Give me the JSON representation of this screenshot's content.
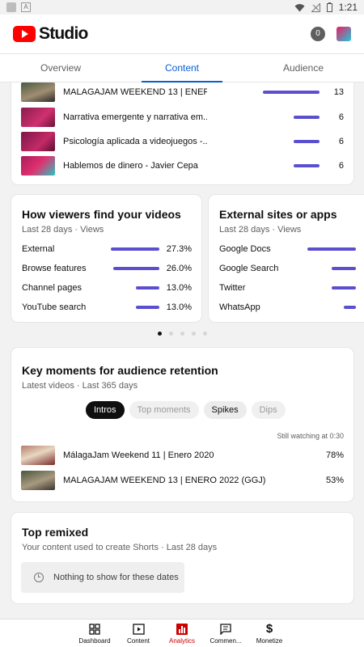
{
  "status_bar": {
    "time": "1:21"
  },
  "header": {
    "logo_text": "Studio",
    "notification_count": "0"
  },
  "tabs": [
    {
      "label": "Overview",
      "active": false
    },
    {
      "label": "Content",
      "active": true
    },
    {
      "label": "Audience",
      "active": false
    }
  ],
  "top_videos": [
    {
      "title": "MALAGAJAM WEEKEND  13 | ENER...",
      "count": "13",
      "bar": 1.0
    },
    {
      "title": "Narrativa emergente y narrativa em...",
      "count": "6",
      "bar": 0.46
    },
    {
      "title": "Psicología aplicada a videojuegos -...",
      "count": "6",
      "bar": 0.46
    },
    {
      "title": "Hablemos de dinero - Javier Cepa",
      "count": "6",
      "bar": 0.46
    }
  ],
  "how_viewers": {
    "title": "How viewers find your videos",
    "subtitle": "Last 28 days · Views",
    "rows": [
      {
        "label": "External",
        "pct": "27.3%",
        "bar": 1.0
      },
      {
        "label": "Browse features",
        "pct": "26.0%",
        "bar": 0.95
      },
      {
        "label": "Channel pages",
        "pct": "13.0%",
        "bar": 0.48
      },
      {
        "label": "YouTube search",
        "pct": "13.0%",
        "bar": 0.48
      }
    ]
  },
  "external_sites": {
    "title": "External sites or apps",
    "subtitle": "Last 28 days · Views",
    "rows": [
      {
        "label": "Google Docs",
        "bar": 1.0
      },
      {
        "label": "Google Search",
        "bar": 0.5
      },
      {
        "label": "Twitter",
        "bar": 0.5
      },
      {
        "label": "WhatsApp",
        "bar": 0.25
      }
    ]
  },
  "key_moments": {
    "title": "Key moments for audience retention",
    "subtitle": "Latest videos · Last 365 days",
    "chips": [
      {
        "label": "Intros",
        "state": "active"
      },
      {
        "label": "Top moments",
        "state": "disabled"
      },
      {
        "label": "Spikes",
        "state": "normal"
      },
      {
        "label": "Dips",
        "state": "disabled"
      }
    ],
    "still_watching": "Still watching at 0:30",
    "rows": [
      {
        "title": "MálagaJam Weekend 11 | Enero 2020",
        "pct": "78%"
      },
      {
        "title": "MALAGAJAM WEEKEND  13 | ENERO 2022 (GGJ)",
        "pct": "53%"
      }
    ]
  },
  "top_remixed": {
    "title": "Top remixed",
    "subtitle": "Your content used to create Shorts · Last 28 days",
    "empty_text": "Nothing to show for these dates"
  },
  "bottom_nav": [
    {
      "label": "Dashboard",
      "icon": "dashboard-icon",
      "active": false
    },
    {
      "label": "Content",
      "icon": "content-icon",
      "active": false
    },
    {
      "label": "Analytics",
      "icon": "analytics-icon",
      "active": true
    },
    {
      "label": "Commen...",
      "icon": "comments-icon",
      "active": false
    },
    {
      "label": "Monetize",
      "icon": "monetize-icon",
      "active": false
    }
  ],
  "colors": {
    "accent": "#065fd4",
    "bar": "#5b4fcf",
    "brand_red": "#ff0000",
    "active_nav": "#cc0000"
  }
}
